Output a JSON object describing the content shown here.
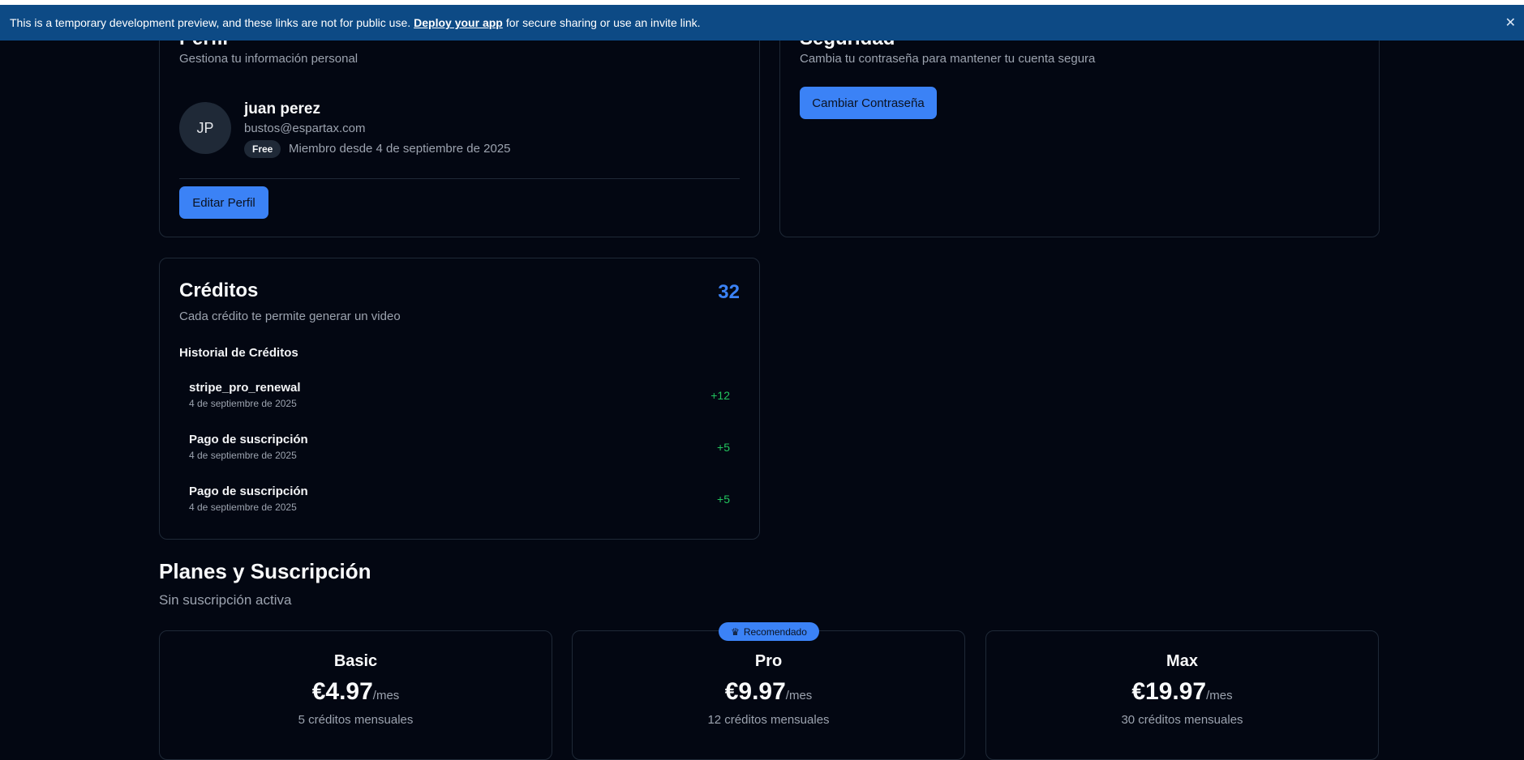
{
  "banner": {
    "text_before": "This is a temporary development preview, and these links are not for public use.",
    "link": "Deploy your app",
    "text_after": "for secure sharing or use an invite link.",
    "close": "✕"
  },
  "profile": {
    "title": "Perfil",
    "subtitle": "Gestiona tu información personal",
    "avatar_initials": "JP",
    "name": "juan perez",
    "email": "bustos@espartax.com",
    "plan_badge": "Free",
    "member_since": "Miembro desde 4 de septiembre de 2025",
    "edit_button": "Editar Perfil"
  },
  "security": {
    "title": "Seguridad",
    "subtitle": "Cambia tu contraseña para mantener tu cuenta segura",
    "change_password_button": "Cambiar Contraseña"
  },
  "credits": {
    "title": "Créditos",
    "count": "32",
    "subtitle": "Cada crédito te permite generar un video",
    "history_title": "Historial de Créditos",
    "history": [
      {
        "name": "stripe_pro_renewal",
        "date": "4 de septiembre de 2025",
        "amount": "+12"
      },
      {
        "name": "Pago de suscripción",
        "date": "4 de septiembre de 2025",
        "amount": "+5"
      },
      {
        "name": "Pago de suscripción",
        "date": "4 de septiembre de 2025",
        "amount": "+5"
      }
    ]
  },
  "plans": {
    "title": "Planes y Suscripción",
    "subtitle": "Sin suscripción activa",
    "recommended_label": "Recomendado",
    "items": [
      {
        "name": "Basic",
        "price": "€4.97",
        "period": "/mes",
        "credits": "5 créditos mensuales"
      },
      {
        "name": "Pro",
        "price": "€9.97",
        "period": "/mes",
        "credits": "12 créditos mensuales"
      },
      {
        "name": "Max",
        "price": "€19.97",
        "period": "/mes",
        "credits": "30 créditos mensuales"
      }
    ]
  },
  "colors": {
    "background": "#030712",
    "banner": "#0d4a85",
    "accent": "#3b82f6",
    "positive": "#22c55e"
  }
}
